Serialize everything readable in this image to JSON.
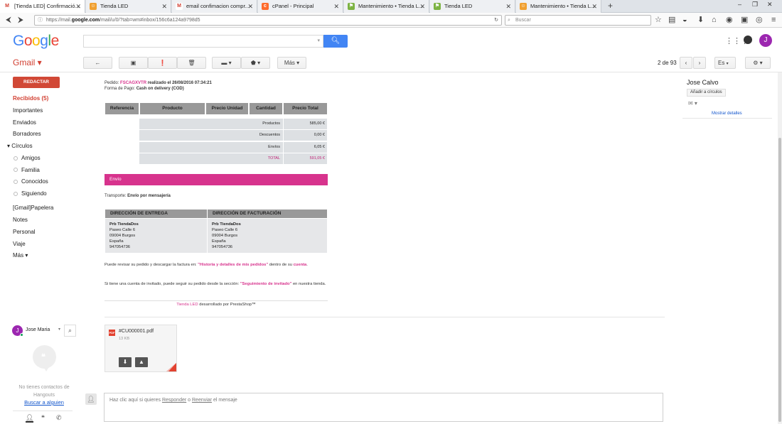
{
  "browser": {
    "tabs": [
      {
        "title": "[Tienda LED] Confirmació...",
        "icon": "gmail-icon",
        "color": "#d23f31"
      },
      {
        "title": "Tienda LED",
        "icon": "prestashop-icon",
        "color": "#f0a030"
      },
      {
        "title": "email confimacion compr...",
        "icon": "gmail-icon",
        "color": "#d23f31"
      },
      {
        "title": "cPanel - Principal",
        "icon": "cpanel-icon",
        "color": "#ff6c2c"
      },
      {
        "title": "Mantenimiento • Tienda L...",
        "icon": "maintenance-icon",
        "color": "#7cb342"
      },
      {
        "title": "Tienda LED",
        "icon": "maintenance-icon",
        "color": "#7cb342"
      },
      {
        "title": "Mantenimiento • Tienda L...",
        "icon": "prestashop-icon",
        "color": "#f0a030"
      }
    ],
    "url_prefix": "https://mail.",
    "url_domain": "google.com",
    "url_path": "/mail/u/0/?tab=wm#inbox/156c6a124a9798d5",
    "search_placeholder": "Buscar"
  },
  "header": {
    "logo": "Google",
    "search_icon": "search-icon",
    "avatar_letter": "J"
  },
  "toolbar": {
    "gmail_label": "Gmail ▾",
    "more_label": "Más ▾",
    "pager": "2 de 93",
    "lang_label": "Es"
  },
  "sidebar": {
    "compose_label": "REDACTAR",
    "items": [
      {
        "label": "Recibidos (5)",
        "bold": true
      },
      {
        "label": "Importantes"
      },
      {
        "label": "Enviados"
      },
      {
        "label": "Borradores"
      },
      {
        "label": "▾ Círculos"
      }
    ],
    "circles": [
      "Amigos",
      "Familia",
      "Conocidos",
      "Siguiendo"
    ],
    "items2": [
      "[Gmail]Papelera",
      "Notes",
      "Personal",
      "Viaje",
      "Más ▾"
    ]
  },
  "email": {
    "order_prefix": "Pedido:",
    "order_ref": "FSCAGXVTR",
    "order_suffix": "realizado el 26/08/2016 07:34:21",
    "payment_prefix": "Forma de Pago:",
    "payment": "Cash on delivery (COD)",
    "columns": [
      "Referencia",
      "Producto",
      "Precio Unidad",
      "Cantidad",
      "Precio Total"
    ],
    "summary": [
      {
        "label": "Productos",
        "value": "585,00 €"
      },
      {
        "label": "Descuentos",
        "value": "0,00 €"
      },
      {
        "label": "Envíos",
        "value": "6,05 €"
      },
      {
        "label": "TOTAL",
        "value": "591,05 €"
      }
    ],
    "envio_label": "Envío",
    "transport_prefix": "Transporte:",
    "transport": "Envío por mensajería",
    "delivery_header": "DIRECCIÓN DE ENTREGA",
    "billing_header": "DIRECCIÓN DE FACTURACIÓN",
    "delivery": [
      "Prb TiendaDos",
      "Paseo Calle 6",
      "09004 Burgos",
      "España",
      "947054736"
    ],
    "billing": [
      "Prb TiendaDos",
      "Paseo Calle 6",
      "09004 Burgos",
      "España",
      "947054736"
    ],
    "note1_a": "Puede revisar su pedido y descargar la factura en:",
    "note1_link": "\"Historia y detalles de mis pedidos\"",
    "note1_b": "dentro de su",
    "note1_link2": "cuenta",
    "note2_a": "Si tiene una cuenta de invitado, puede seguir su pedido desde la sección:",
    "note2_link": "\"Seguimiento de invitado\"",
    "note2_b": "en nuestra tienda.",
    "footer_link": "Tienda LED",
    "footer_text": "desarrollado por PrestaShop™"
  },
  "attachment": {
    "badge": "PDF",
    "name": "#CU000001.pdf",
    "size": "13 KB"
  },
  "reply": {
    "text_a": "Haz clic aquí si quieres",
    "link1": "Responder",
    "text_b": "o",
    "link2": "Reenviar",
    "text_c": "el mensaje"
  },
  "contact_panel": {
    "name": "Jose Calvo",
    "add_button": "Añadir a círculos",
    "details_link": "Mostrar detalles"
  },
  "hangouts": {
    "user": "Jose Maria",
    "empty_text1": "No tienes contactos de",
    "empty_text2": "Hangouts",
    "find_link": "Buscar a alguien"
  },
  "colors": {
    "accent_pink": "#d7338d",
    "gmail_red": "#d23f31",
    "google_blue": "#4285f4"
  }
}
